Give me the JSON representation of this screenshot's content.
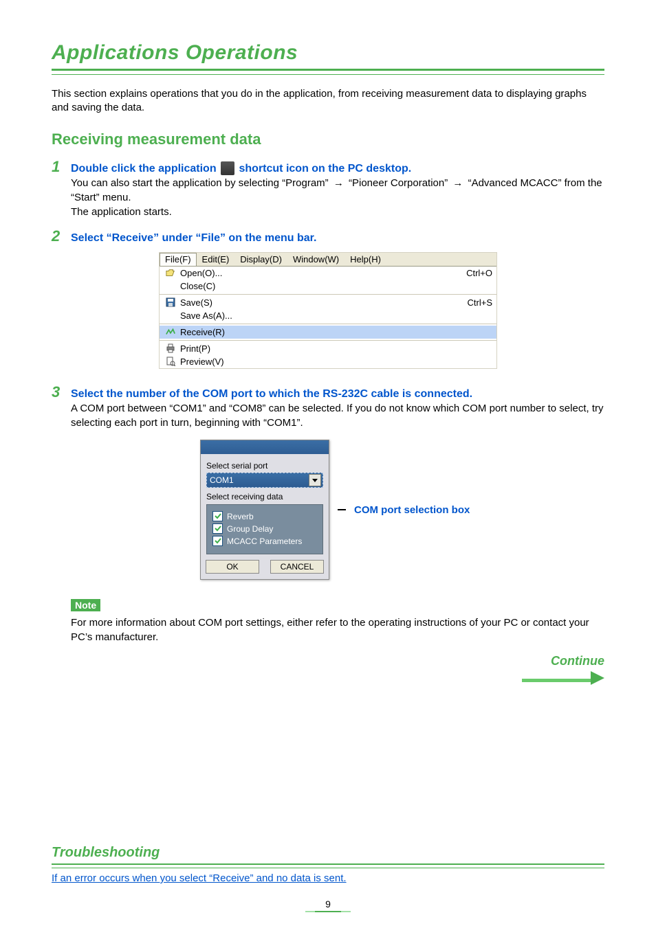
{
  "title_main": "Applications Operations",
  "intro": "This section explains operations that you do in the application, from receiving measurement data to displaying graphs and saving the data.",
  "section_heading": "Receiving measurement data",
  "steps": {
    "s1": {
      "num": "1",
      "title_before": "Double click the application ",
      "title_after": " shortcut icon on the PC desktop.",
      "body_l1": "You can also start the application by selecting “Program” ",
      "body_l2": " “Pioneer Corporation” ",
      "body_l3": " “Advanced MCACC” from the “Start” menu.",
      "body_l4": "The application starts."
    },
    "s2": {
      "num": "2",
      "title": "Select “Receive” under “File” on the menu bar."
    },
    "s3": {
      "num": "3",
      "title": "Select the number of the COM port to which the RS-232C cable is connected.",
      "body": "A COM port between “COM1” and “COM8” can be selected. If you do not know which COM port number to select, try selecting each port in turn, beginning with “COM1”."
    }
  },
  "arrow_glyph": "→",
  "menu": {
    "bar": [
      "File(F)",
      "Edit(E)",
      "Display(D)",
      "Window(W)",
      "Help(H)"
    ],
    "items": [
      {
        "icon": "open-icon",
        "label": "Open(O)...",
        "shortcut": "Ctrl+O"
      },
      {
        "icon": "",
        "label": "Close(C)",
        "shortcut": ""
      },
      {
        "sep": true
      },
      {
        "icon": "save-icon",
        "label": "Save(S)",
        "shortcut": "Ctrl+S"
      },
      {
        "icon": "",
        "label": "Save As(A)...",
        "shortcut": ""
      },
      {
        "sep": true
      },
      {
        "icon": "receive-icon",
        "label": "Receive(R)",
        "shortcut": "",
        "highlight": true
      },
      {
        "sep": true
      },
      {
        "icon": "print-icon",
        "label": "Print(P)",
        "shortcut": ""
      },
      {
        "icon": "preview-icon",
        "label": "Preview(V)",
        "shortcut": ""
      }
    ]
  },
  "com_dialog": {
    "label_port": "Select serial port",
    "selected": "COM1",
    "label_data": "Select receiving data",
    "checks": [
      "Reverb",
      "Group Delay",
      "MCACC Parameters"
    ],
    "ok": "OK",
    "cancel": "CANCEL",
    "callout": "COM port selection box"
  },
  "note": {
    "label": "Note",
    "text": "For more information about COM port settings, either refer to the operating instructions of your PC or contact your PC’s manufacturer."
  },
  "continue_label": "Continue",
  "troubleshoot": {
    "heading": "Troubleshooting",
    "link": "If an error occurs when you select “Receive” and no data is sent."
  },
  "page_number": "9"
}
